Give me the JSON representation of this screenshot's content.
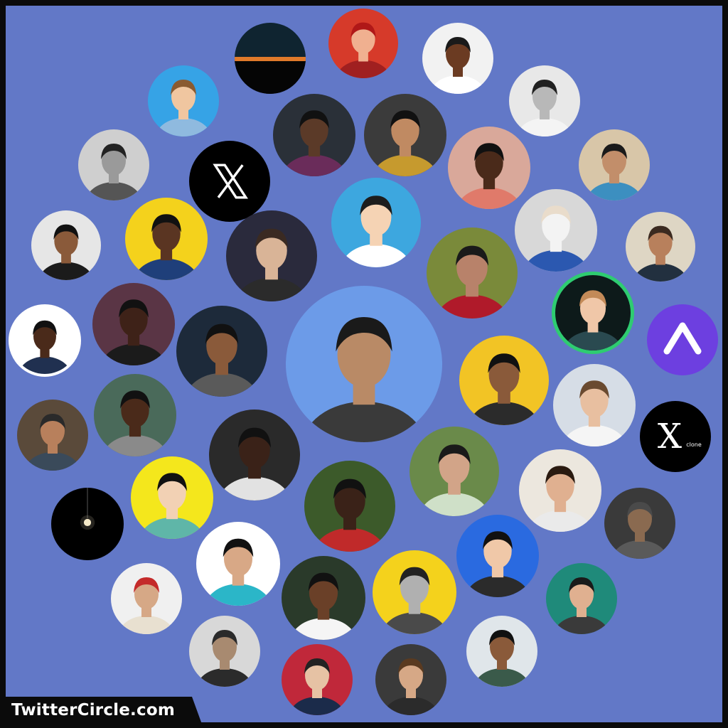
{
  "brand": {
    "label": "TwitterCircle.com"
  },
  "colors": {
    "canvas": "#6278c7",
    "frame": "#0b0b0b",
    "brand_text": "#ffffff"
  },
  "icons": {
    "x_logo": "x-logo-icon",
    "x_clone_logo": "x-clone-logo-icon",
    "arc_logo": "arc-logo-icon",
    "lightbulb": "lightbulb-icon"
  },
  "x_clone": {
    "letter": "X",
    "sub": "clone"
  }
}
